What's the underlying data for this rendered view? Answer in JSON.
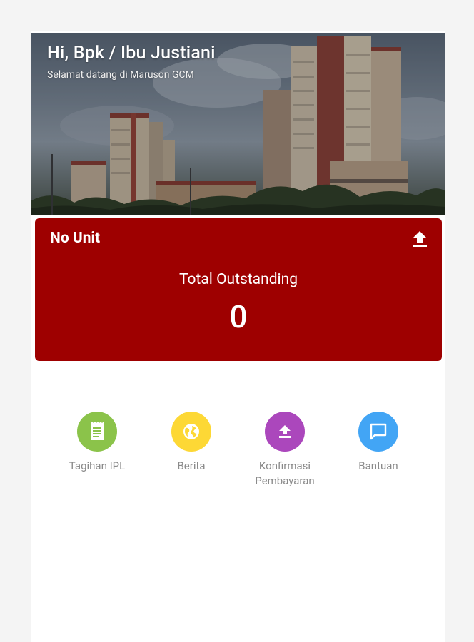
{
  "header": {
    "greeting": "Hi, Bpk / Ibu Justiani",
    "welcome": "Selamat datang di Maruson GCM"
  },
  "card": {
    "unit_label": "No Unit",
    "outstanding_label": "Total Outstanding",
    "outstanding_value": "0",
    "upload_icon": "upload-icon",
    "background_color": "#9e0000"
  },
  "menu": {
    "items": [
      {
        "label": "Tagihan IPL",
        "icon": "receipt-icon",
        "color": "#8bc34a"
      },
      {
        "label": "Berita",
        "icon": "globe-icon",
        "color": "#fdd835"
      },
      {
        "label": "Konfirmasi Pembayaran",
        "icon": "upload-icon",
        "color": "#ab47bc"
      },
      {
        "label": "Bantuan",
        "icon": "chat-icon",
        "color": "#42a5f5"
      }
    ]
  }
}
